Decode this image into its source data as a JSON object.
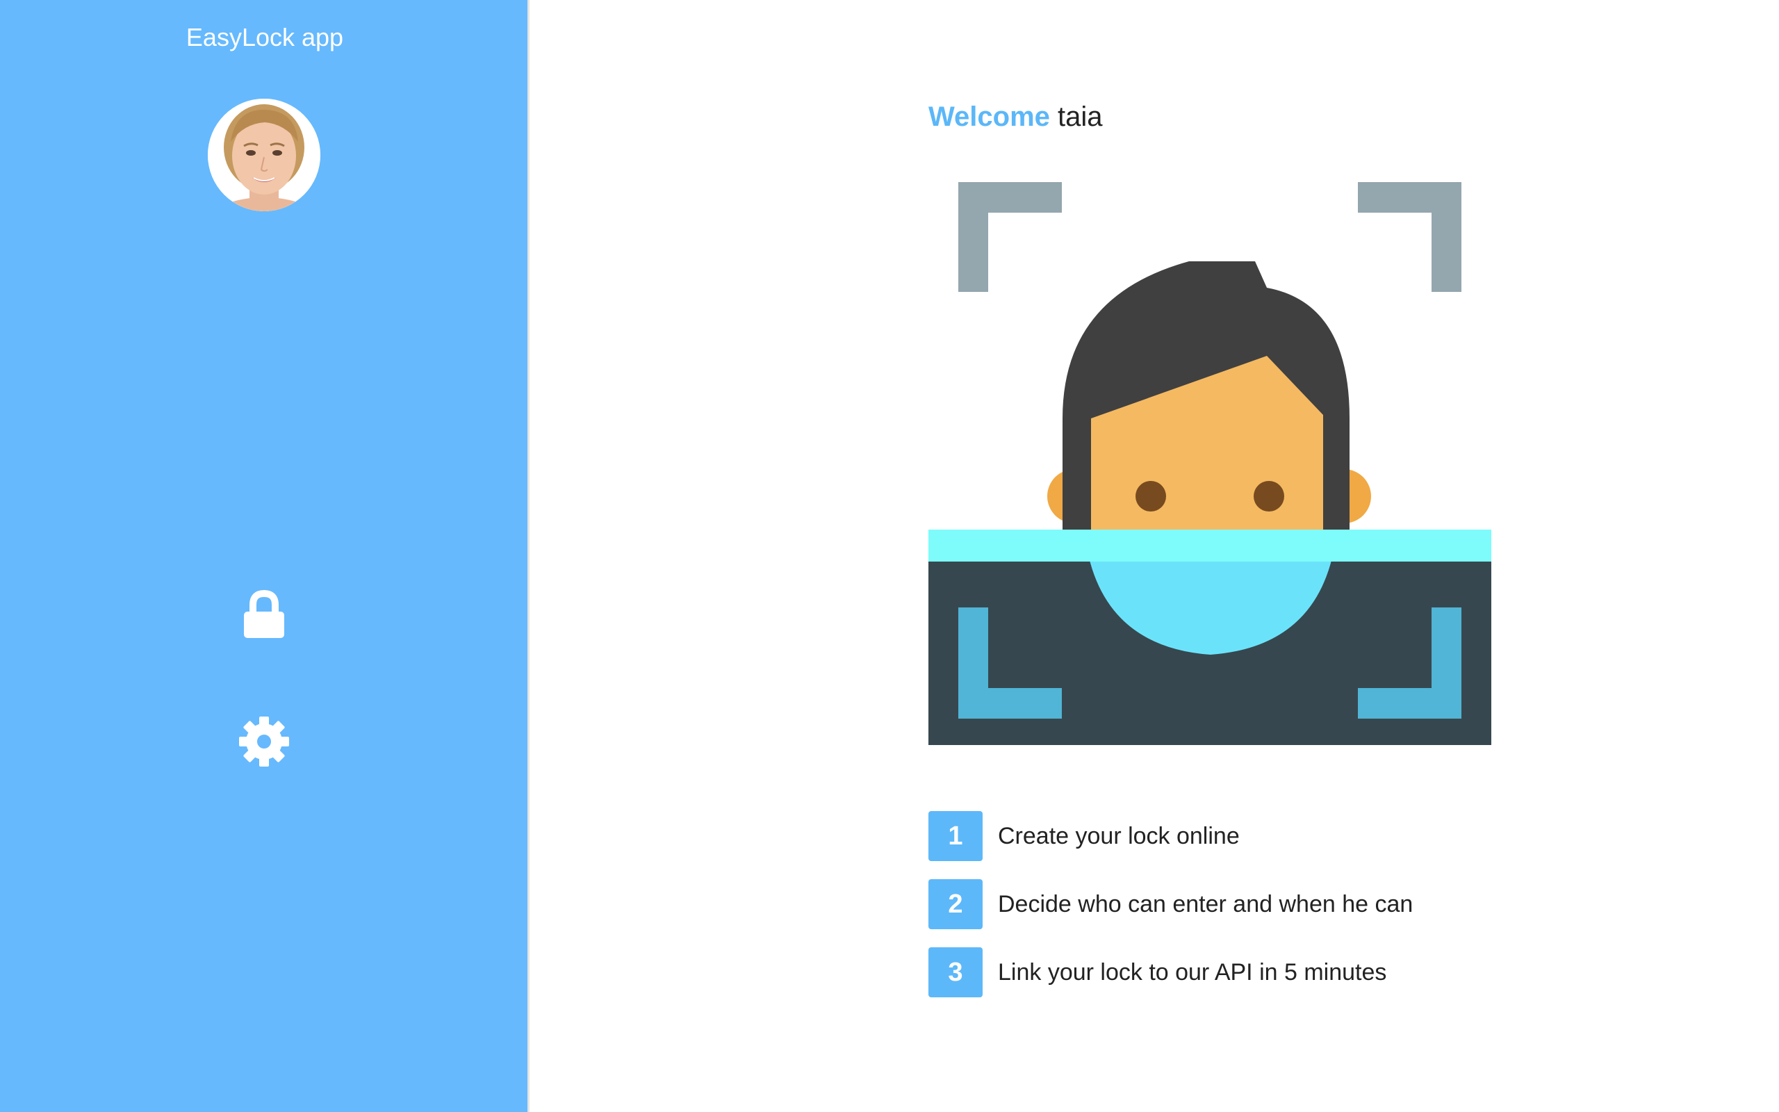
{
  "sidebar": {
    "app_title": "EasyLock app",
    "avatar_icon": "user-avatar",
    "nav": [
      {
        "icon": "lock-icon"
      },
      {
        "icon": "gear-icon"
      }
    ]
  },
  "main": {
    "welcome_highlight": "Welcome",
    "welcome_user": "taia",
    "illustration_icon": "face-scan-icon",
    "steps": [
      {
        "number": "1",
        "text": "Create your lock online"
      },
      {
        "number": "2",
        "text": "Decide who can enter and when he can"
      },
      {
        "number": "3",
        "text": "Link your lock to our API in 5 minutes"
      }
    ]
  },
  "colors": {
    "sidebar_bg": "#66b9fd",
    "accent": "#5bb7f8",
    "text": "#222222",
    "scan_bar": "#7efcfb",
    "panel_dark": "#37474f",
    "frame_gray": "#94a6ae",
    "hair": "#404040",
    "skin": "#f5b961"
  }
}
